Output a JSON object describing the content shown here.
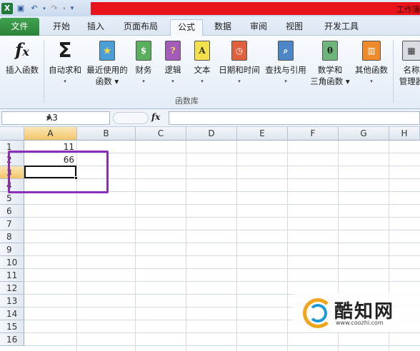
{
  "titlebar": {
    "title": "工作簿",
    "qat": [
      "excel-icon",
      "save-icon",
      "undo-icon",
      "redo-icon",
      "customize-icon"
    ]
  },
  "tabs": [
    "文件",
    "开始",
    "插入",
    "页面布局",
    "公式",
    "数据",
    "审阅",
    "视图",
    "开发工具"
  ],
  "active_tab": "公式",
  "ribbon": {
    "buttons": [
      {
        "l1": "插入函数",
        "l2": ""
      },
      {
        "l1": "自动求和",
        "l2": "▾"
      },
      {
        "l1": "最近使用的",
        "l2": "函数 ▾"
      },
      {
        "l1": "财务",
        "l2": "▾"
      },
      {
        "l1": "逻辑",
        "l2": "▾"
      },
      {
        "l1": "文本",
        "l2": "▾"
      },
      {
        "l1": "日期和时间",
        "l2": "▾"
      },
      {
        "l1": "查找与引用",
        "l2": "▾"
      },
      {
        "l1": "数学和",
        "l2": "三角函数 ▾"
      },
      {
        "l1": "其他函数",
        "l2": "▾"
      },
      {
        "l1": "名称",
        "l2": "管理器"
      }
    ],
    "group_label": "函数库",
    "icon_glyphs": {
      "insert": "fx",
      "sum": "Σ",
      "recent": "★",
      "financial": "$",
      "logical": "?",
      "text": "A",
      "date": "◷",
      "lookup": "🔍",
      "math": "θ",
      "more": "▥",
      "name": "▦"
    }
  },
  "formula_bar": {
    "name_box": "A3",
    "fx": "fx",
    "value": ""
  },
  "columns": [
    "A",
    "B",
    "C",
    "D",
    "E",
    "F",
    "G",
    "H"
  ],
  "rows": [
    "1",
    "2",
    "3",
    "4",
    "5",
    "6",
    "7",
    "8",
    "9",
    "10",
    "11",
    "12",
    "13",
    "14",
    "15",
    "16"
  ],
  "cells": {
    "A1": "11",
    "A2": "66"
  },
  "watermark": {
    "text": "酷知网",
    "url": "www.coozhi.com"
  },
  "colors": {
    "file_tab": "#2a8239",
    "highlight": "#8b2fb8",
    "selection_header": "#f2c56a",
    "titlebar_red": "#e8131b"
  }
}
